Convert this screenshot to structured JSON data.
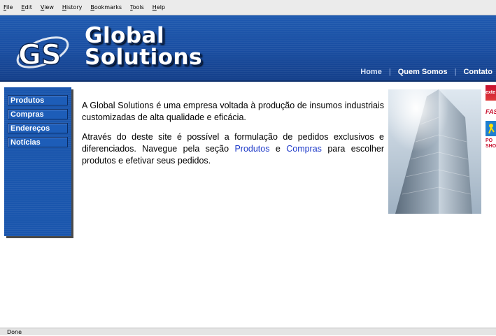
{
  "browser": {
    "menu": [
      "File",
      "Edit",
      "View",
      "History",
      "Bookmarks",
      "Tools",
      "Help"
    ],
    "status": "Done"
  },
  "header": {
    "logo_text": "GS",
    "brand_line1": "Global",
    "brand_line2": "Solutions",
    "nav": [
      "Home",
      "Quem Somos",
      "Contato"
    ]
  },
  "sidebar": {
    "items": [
      "Produtos",
      "Compras",
      "Endereços",
      "Notícias"
    ]
  },
  "main": {
    "paragraph1": "A Global Solutions é uma empresa voltada à produção de insumos industriais customizadas de alta qualidade e eficácia.",
    "p2_before": "Através do deste site é possível a formulação de pedidos exclusivos e diferenciados. Navegue pela seção ",
    "p2_link1": "Produtos",
    "p2_mid": " e ",
    "p2_link2": "Compras",
    "p2_after": " para escolher produtos e efetivar seus pedidos."
  },
  "banners": {
    "b1": "exte",
    "b2": "FAS",
    "b4_line1": "PO",
    "b4_line2": "SHO"
  },
  "colors": {
    "header_blue": "#1a4fa3",
    "sidebar_blue": "#1a56ad",
    "link_blue": "#1d39c8"
  }
}
